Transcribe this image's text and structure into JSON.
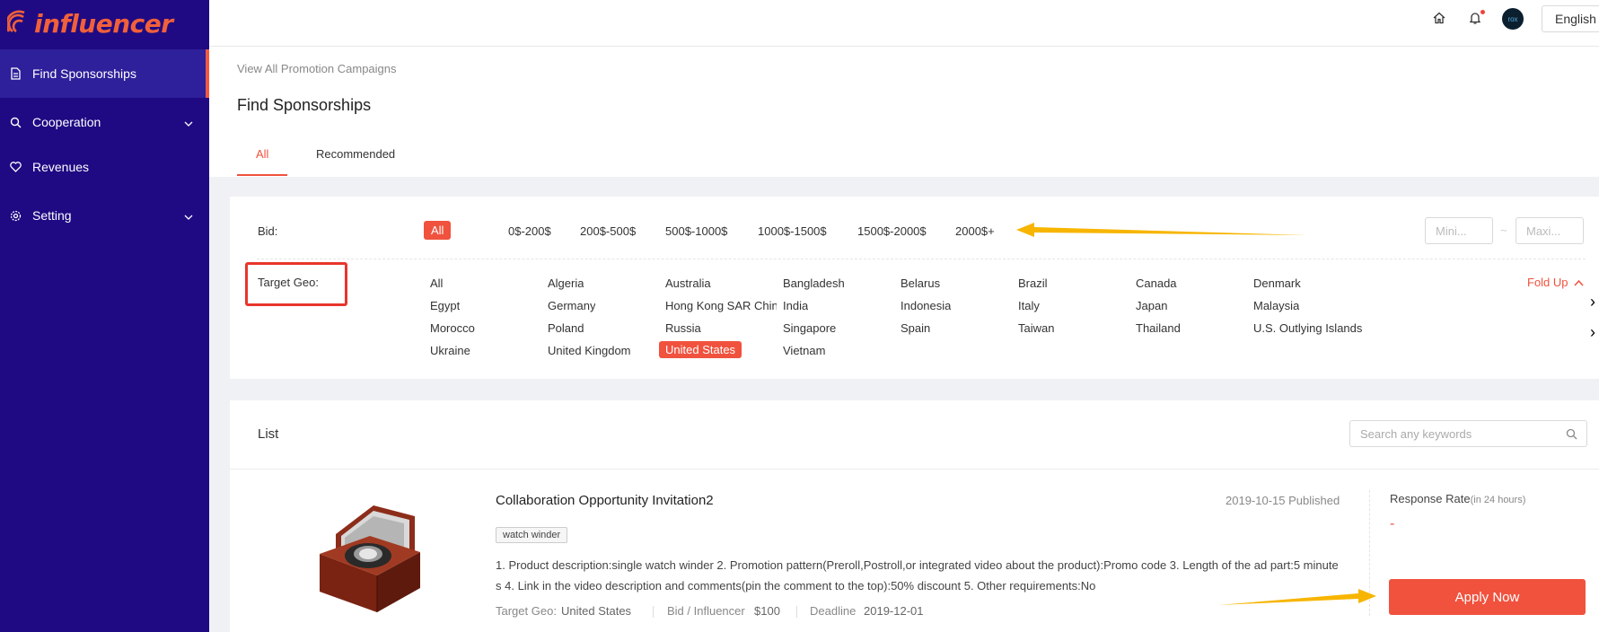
{
  "app": {
    "logo_text": "influencer"
  },
  "sidebar": {
    "items": [
      {
        "label": "Find Sponsorships",
        "icon": "document-icon",
        "active": true
      },
      {
        "label": "Cooperation",
        "icon": "search-icon",
        "expandable": true
      },
      {
        "label": "Revenues",
        "icon": "heart-icon"
      },
      {
        "label": "Setting",
        "icon": "gear-icon",
        "expandable": true
      }
    ]
  },
  "topbar": {
    "language": "English",
    "avatar_text": "rox",
    "icons": [
      "home-icon",
      "bell-icon"
    ]
  },
  "header": {
    "breadcrumb": "View All Promotion Campaigns",
    "title": "Find Sponsorships",
    "tabs": [
      {
        "label": "All",
        "active": true
      },
      {
        "label": "Recommended",
        "active": false
      }
    ]
  },
  "filters": {
    "bid_label": "Bid:",
    "bid_options": [
      "All",
      "0$-200$",
      "200$-500$",
      "500$-1000$",
      "1000$-1500$",
      "1500$-2000$",
      "2000$+"
    ],
    "bid_selected": "All",
    "min_placeholder": "Mini...",
    "max_placeholder": "Maxi...",
    "range_separator": "~",
    "geo_label": "Target Geo:",
    "geo_options": [
      "All",
      "Algeria",
      "Australia",
      "Bangladesh",
      "Belarus",
      "Brazil",
      "Canada",
      "Denmark",
      "Egypt",
      "Germany",
      "Hong Kong SAR China",
      "India",
      "Indonesia",
      "Italy",
      "Japan",
      "Malaysia",
      "Morocco",
      "Poland",
      "Russia",
      "Singapore",
      "Spain",
      "Taiwan",
      "Thailand",
      "U.S. Outlying Islands",
      "Ukraine",
      "United Kingdom",
      "United States",
      "Vietnam"
    ],
    "geo_selected": "United States",
    "fold_label": "Fold Up"
  },
  "list": {
    "title": "List",
    "search_placeholder": "Search any keywords",
    "items": [
      {
        "title": "Collaboration Opportunity Invitation2",
        "published": "2019-10-15 Published",
        "tag": "watch winder",
        "description": "1. Product description:single watch winder 2. Promotion pattern(Preroll,Postroll,or integrated video about the product):Promo code 3. Length of the ad part:5 minutes 4. Link in the video description and comments(pin the comment to the top):50% discount 5. Other requirements:No",
        "geo_label": "Target Geo:",
        "geo_value": "United States",
        "bid_label": "Bid / Influencer",
        "bid_value": "$100",
        "deadline_label": "Deadline",
        "deadline_value": "2019-12-01",
        "response_rate_label": "Response Rate",
        "response_rate_sub": "(in 24 hours)",
        "response_rate_value": "-",
        "apply_label": "Apply Now"
      }
    ]
  },
  "colors": {
    "sidebar_bg": "#1f0a83",
    "accent": "#f0523e",
    "annotation_arrow": "#f7b500",
    "annotation_box": "#e8352c"
  }
}
